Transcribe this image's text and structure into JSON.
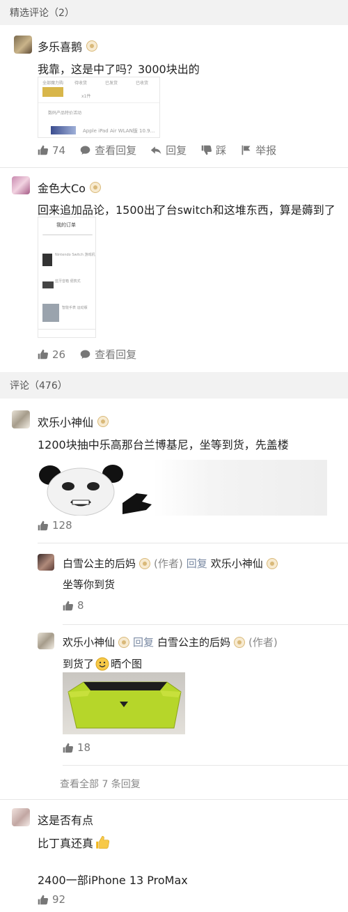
{
  "featured": {
    "header": "精选评论（2）",
    "comments": [
      {
        "user": "多乐喜鹅",
        "text": "我靠，这是中了吗？3000块出的",
        "screenshot": {
          "tabs": [
            "全部魔力购",
            "待收货",
            "已发货",
            "已收货"
          ],
          "small_label": "x1件",
          "row_label": "数码产品特价活动",
          "product": "Apple iPad Air WLAN版 10.9..."
        },
        "actions": {
          "likes": "74",
          "view_replies": "查看回复",
          "reply": "回复",
          "dislike": "踩",
          "report": "举报"
        }
      },
      {
        "user": "金色大Co",
        "text": "回来追加品论，1500出了台switch和这堆东西，算是薅到了",
        "screenshot": {
          "title": "我的订单",
          "rows": [
            "Nintendo Switch 游戏机",
            "蓝牙音箱 便携式",
            "智能手表 运动版"
          ]
        },
        "actions": {
          "likes": "26",
          "view_replies": "查看回复"
        }
      }
    ]
  },
  "comments": {
    "header": "评论（476）",
    "items": [
      {
        "user": "欢乐小神仙",
        "text": "1200块抽中乐高那台兰博基尼，坐等到货，先盖楼",
        "likes": "128",
        "replies": [
          {
            "user": "白雪公主的后妈",
            "author_tag": "(作者)",
            "reply_word": "回复",
            "to": "欢乐小神仙",
            "text": "坐等你到货",
            "likes": "8"
          },
          {
            "user": "欢乐小神仙",
            "reply_word": "回复",
            "to": "白雪公主的后妈",
            "author_tag": "(作者)",
            "text_before": "到货了",
            "text_after": "晒个图",
            "likes": "18"
          }
        ],
        "view_all": "查看全部 7 条回复"
      },
      {
        "user": "这是否有点",
        "line1": "比丁真还真",
        "line2": "2400一部iPhone 13 ProMax",
        "likes": "92"
      }
    ]
  },
  "colors": {
    "accent_link": "#7a8aa3",
    "product_green": "#b6d62a",
    "header_bg": "#f2f2f2"
  }
}
